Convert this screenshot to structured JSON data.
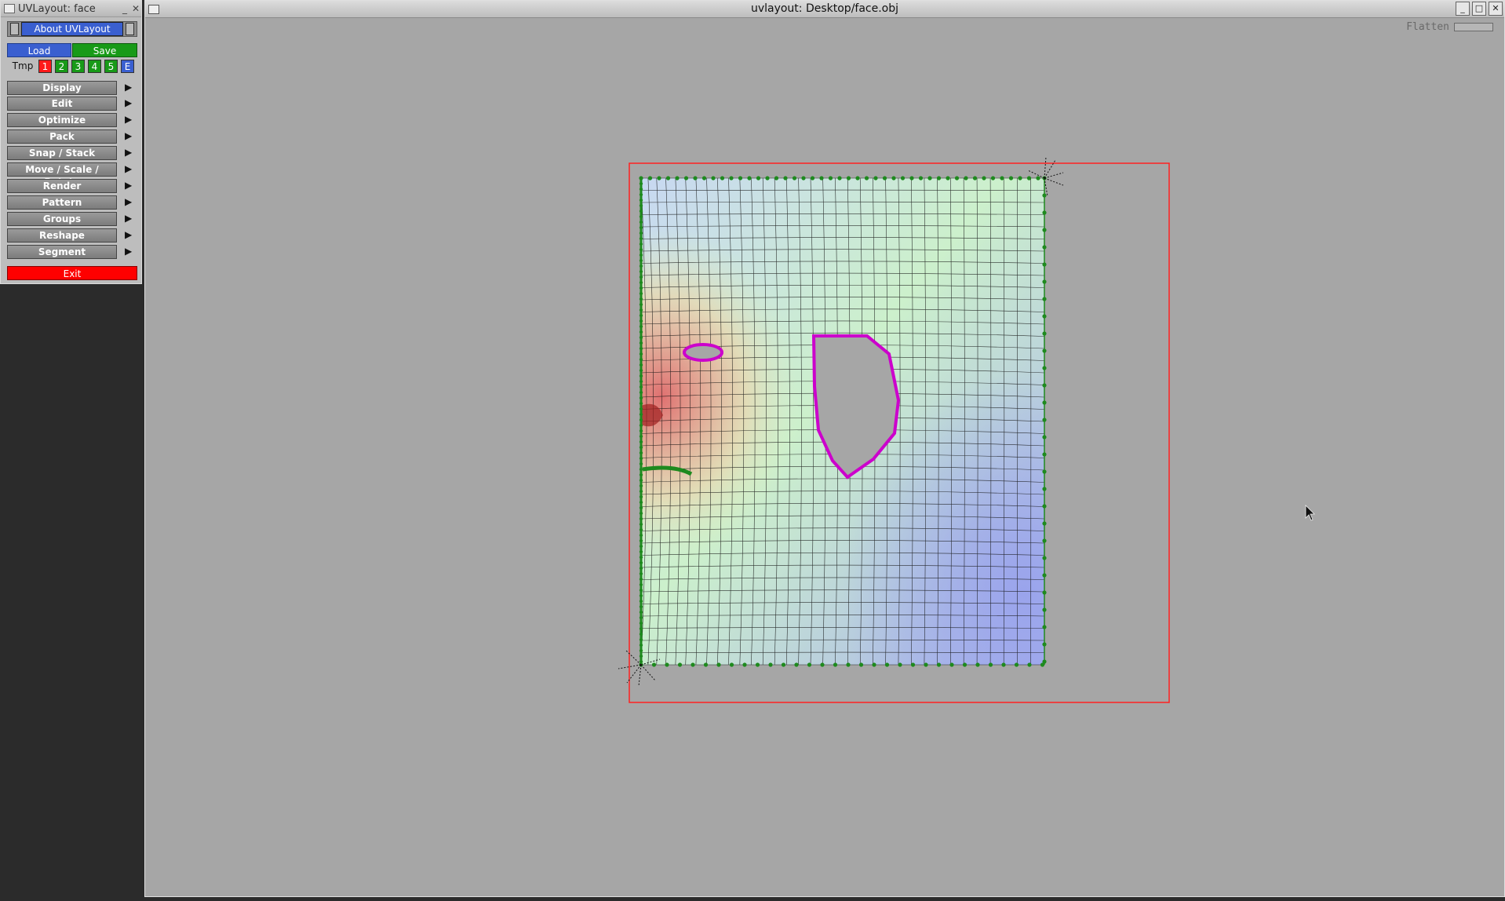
{
  "tool_window": {
    "title": "UVLayout: face",
    "minimize_glyph": "_",
    "close_glyph": "✕",
    "about_label": "About UVLayout",
    "load_label": "Load",
    "save_label": "Save",
    "tmp_label": "Tmp",
    "slots": [
      {
        "label": "1",
        "color": "#ff1a1a"
      },
      {
        "label": "2",
        "color": "#189a18"
      },
      {
        "label": "3",
        "color": "#189a18"
      },
      {
        "label": "4",
        "color": "#189a18"
      },
      {
        "label": "5",
        "color": "#189a18"
      },
      {
        "label": "E",
        "color": "#3a5fd0"
      }
    ],
    "menu": [
      {
        "label": "Display"
      },
      {
        "label": "Edit"
      },
      {
        "label": "Optimize"
      },
      {
        "label": "Pack"
      },
      {
        "label": "Snap / Stack"
      },
      {
        "label": "Move / Scale / Rotate"
      },
      {
        "label": "Render"
      },
      {
        "label": "Pattern"
      },
      {
        "label": "Groups"
      },
      {
        "label": "Reshape"
      },
      {
        "label": "Segment"
      }
    ],
    "arrow_glyph": "▶",
    "exit_label": "Exit"
  },
  "main_window": {
    "title": "uvlayout: Desktop/face.obj",
    "flatten_label": "Flatten",
    "controls": [
      "_",
      "□",
      "✕"
    ]
  },
  "colors": {
    "viewport_bg": "#a6a6a6",
    "bounds_rect": "#ff2020",
    "boundary_dots": "#1e8a1e",
    "hole_outline": "#cc00cc",
    "mesh_line": "#111111"
  }
}
